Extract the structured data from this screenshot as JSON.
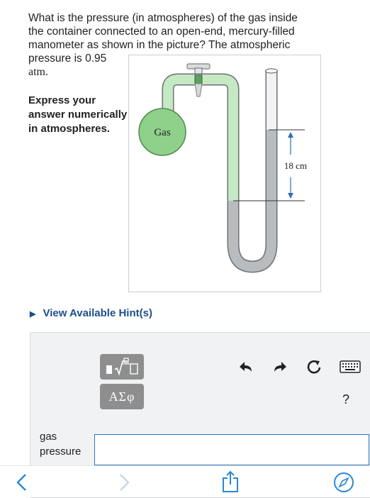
{
  "question": {
    "line1": "What is the pressure (in atmospheres) of the gas inside",
    "line2": "the container connected to an open-end, mercury-filled",
    "line3": "manometer as shown in the picture? The atmospheric",
    "line4": "pressure is 0.95",
    "unit": "atm."
  },
  "instruction": "Express your answer numerically in atmospheres.",
  "figure": {
    "gas_label": "Gas",
    "height_label": "18 cm"
  },
  "hints_label": "View Available Hint(s)",
  "toolbar": {
    "greek_label": "ΑΣφ",
    "help_label": "?"
  },
  "answer": {
    "label": "gas pressure",
    "value": ""
  },
  "colors": {
    "accent": "#1c4f8c",
    "tool_button": "#8e8e8e",
    "gas_green": "#8fd18b",
    "tube_fill": "#c5e9c3",
    "mercury": "#b8bcbf",
    "nav_blue": "#2a86d6"
  },
  "icons": [
    "undo-icon",
    "redo-icon",
    "reset-icon",
    "keyboard-icon",
    "back-chevron-icon",
    "forward-chevron-icon",
    "share-icon",
    "compass-icon",
    "fraction-sqrt-icon"
  ]
}
